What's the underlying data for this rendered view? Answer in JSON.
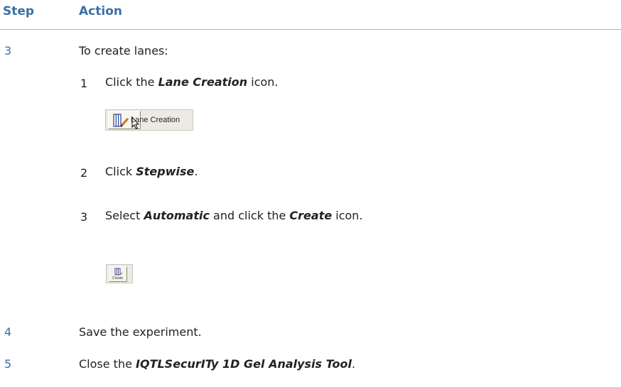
{
  "header": {
    "step_label": "Step",
    "action_label": "Action"
  },
  "steps": [
    {
      "number": "3",
      "text": "To create lanes:"
    },
    {
      "number": "4",
      "text": "Save the experiment."
    },
    {
      "number": "5",
      "text_pre": "Close the ",
      "text_em": "IQTLSecurITy 1D Gel Analysis Tool",
      "text_post": "."
    }
  ],
  "substeps": [
    {
      "number": "1",
      "pre": "Click the ",
      "em": "Lane Creation",
      "post": " icon."
    },
    {
      "number": "2",
      "pre": "Click ",
      "em": "Stepwise",
      "post": "."
    },
    {
      "number": "3",
      "pre": "Select ",
      "em": "Automatic",
      "mid": " and click the ",
      "em2": "Create",
      "post": " icon."
    }
  ],
  "lane_creation_button": {
    "label": "Lane Creation",
    "icon": "lane-creation-icon"
  },
  "create_button": {
    "label": "Create",
    "icon": "create-lanes-icon"
  },
  "colors": {
    "heading": "#3c6ea7",
    "rule": "#9fb8d3",
    "text": "#222222"
  }
}
